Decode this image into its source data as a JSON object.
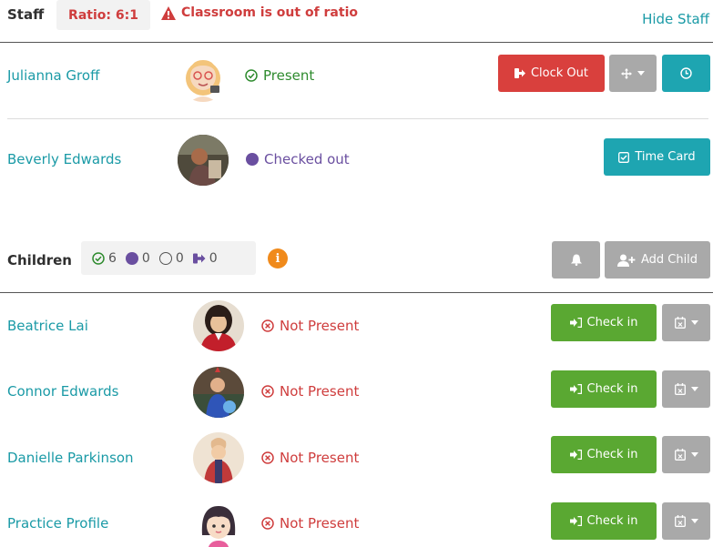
{
  "staff_header": {
    "title": "Staff",
    "ratio": "Ratio: 6:1",
    "warning": "Classroom is out of ratio",
    "toggle_link": "Hide Staff"
  },
  "staff": [
    {
      "name": "Julianna Groff",
      "status": "Present",
      "actions": {
        "clock_out": "Clock Out"
      }
    },
    {
      "name": "Beverly Edwards",
      "status": "Checked out",
      "actions": {
        "time_card": "Time Card"
      }
    }
  ],
  "children_header": {
    "title": "Children",
    "counts": {
      "present": "6",
      "checked_out": "0",
      "absent": "0",
      "transferred": "0"
    },
    "info": "i",
    "add_child": "Add Child"
  },
  "children": [
    {
      "name": "Beatrice Lai",
      "status": "Not Present",
      "check_in": "Check in"
    },
    {
      "name": "Connor Edwards",
      "status": "Not Present",
      "check_in": "Check in"
    },
    {
      "name": "Danielle Parkinson",
      "status": "Not Present",
      "check_in": "Check in"
    },
    {
      "name": "Practice Profile",
      "status": "Not Present",
      "check_in": "Check in"
    }
  ],
  "colors": {
    "accent": "#1a9aa6",
    "danger": "#d9403d",
    "success": "#5aa832",
    "checked_out": "#6a4fa0"
  }
}
